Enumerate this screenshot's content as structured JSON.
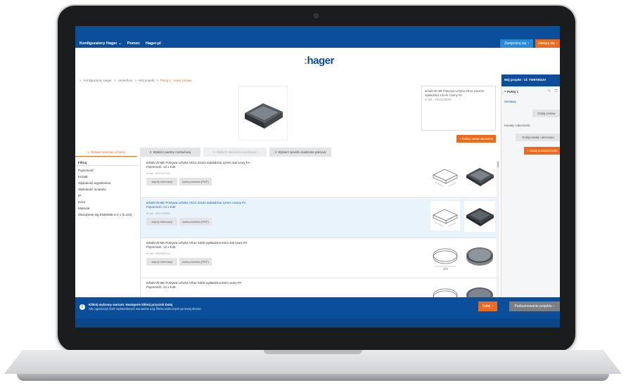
{
  "topbar": {
    "links": [
      "Konfiguratory Hager",
      "Pomoc",
      "Hager.pl"
    ],
    "chevron": "chevron-down-icon",
    "register_label": "Zarejestruj się",
    "login_label": "Zaloguj się"
  },
  "logo": {
    "colon": ":",
    "text": "hager"
  },
  "breadcrumb": {
    "items": [
      "Konfiguratory Hager",
      "Underfloor",
      "Mój projekt",
      "Pokój 1 - nowy zestaw"
    ],
    "separator": ">"
  },
  "product_detail": {
    "line1": "tehalit.VE-BE Pokrywa uchyha VE12 24x24m",
    "line2": "wykładzina 12mm czarny PA",
    "line3": "nr kat.: VE12129051"
  },
  "add_accessories_label": "+ Dodaj i ustaw akcesoria",
  "steps": [
    "1. Wybierz pokrywę uchylną",
    "2. Wybierz puszkę montażową",
    "3. Wybierz akcesoria dodatkowe",
    "4. Wybierz sposób osadzenia pokrywy"
  ],
  "filters": {
    "header": "Filtruj",
    "items": [
      "Pojemność",
      "Kształt",
      "Głębokość wypełnienia",
      "Głębokość montażu",
      "IP",
      "Kolor",
      "Materiał",
      "Obciążenie wg EN50085-2-2 1 (k.103)"
    ]
  },
  "products": [
    {
      "line1": "tehalit.VE-BE Pokrywa uchyha VE12 24x24 wykładzina 12mm stal szary PA",
      "line2": "Pojemność: 12 x K45",
      "code": "nr kat.: VE12127111",
      "more_label": "więcej informacji",
      "pdf_label": "karta produktu (PDF)"
    },
    {
      "line1": "tehalit.VE-BE Pokrywa uchyha VE12 24x24 wykładzina 12mm czarny PA",
      "line2": "Pojemność: 12 x K45",
      "code": "nr kat.: VE12129051",
      "more_label": "więcej informacji",
      "pdf_label": "karta produktu (PDF)"
    },
    {
      "line1": "tehalit.VE-BE Pokrywa uchyha VR12 S300 wykładzina 5mm stal szary PA",
      "line2": "Pojemność: 12 x K45",
      "code": "nr kat.: VR12057111",
      "more_label": "więcej informacji",
      "pdf_label": "karta produktu (PDF)"
    },
    {
      "line1": "tehalit.VE-BE Pokrywa uchyha VR12 S300 wykładzina 5mm szary PA",
      "line2": "Pojemność: 12 x K45",
      "code": "",
      "more_label": "",
      "pdf_label": ""
    }
  ],
  "side": {
    "project": "Mój projekt - id: TW5T8GUV",
    "room": "Pokój 1",
    "sets": "Zestawy",
    "add_set": "Dodaj zestaw",
    "channels": "Kanały i akcesoria",
    "add_channels": "Dodaj kanały i akcesoria",
    "add_room": "+ Dodaj pomieszczenie"
  },
  "footer": {
    "line1": "Kliknij wybrany wariant. Następnie kliknij przycisk Dalej",
    "line2": "Aby ograniczyć ilość wyświetlanych wariantów użyj filtrów widocznych po lewej stronie.",
    "next_label": "Dalej",
    "summary_label": "Podsumowanie projektu"
  },
  "dimension_label": "325"
}
